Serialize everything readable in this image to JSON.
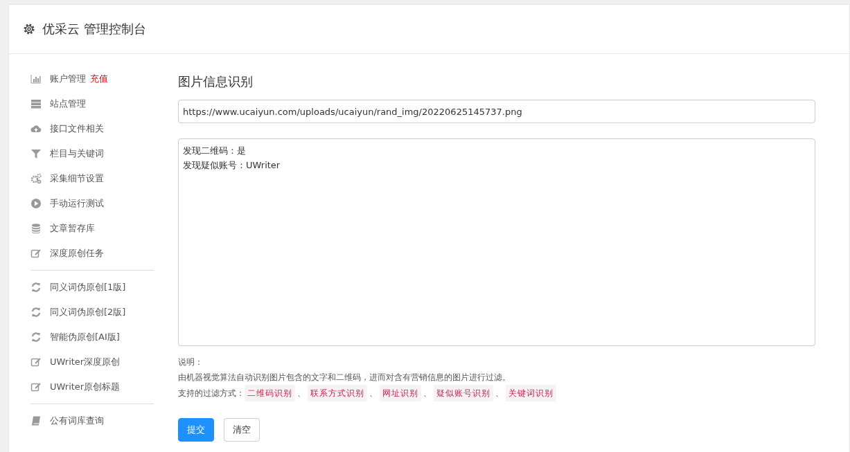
{
  "header": {
    "title": "优采云 管理控制台"
  },
  "sidebar": {
    "groups": [
      {
        "items": [
          {
            "label": "账户管理",
            "badge": "充值"
          },
          {
            "label": "站点管理"
          },
          {
            "label": "接口文件相关"
          },
          {
            "label": "栏目与关键词"
          },
          {
            "label": "采集细节设置"
          },
          {
            "label": "手动运行测试"
          },
          {
            "label": "文章暂存库"
          },
          {
            "label": "深度原创任务"
          }
        ]
      },
      {
        "items": [
          {
            "label": "同义词伪原创[1版]"
          },
          {
            "label": "同义词伪原创[2版]"
          },
          {
            "label": "智能伪原创[AI版]"
          },
          {
            "label": "UWriter深度原创"
          },
          {
            "label": "UWriter原创标题"
          }
        ]
      },
      {
        "items": [
          {
            "label": "公有词库查询"
          }
        ]
      }
    ]
  },
  "main": {
    "title": "图片信息识别",
    "url_field": {
      "value": "https://www.ucaiyun.com/uploads/ucaiyun/rand_img/20220625145737.png"
    },
    "result": {
      "lines": [
        "发现二维码：是",
        "发现疑似账号：UWriter"
      ]
    },
    "note_heading": "说明：",
    "note_text": "由机器视觉算法自动识别图片包含的文字和二维码，进而对含有营销信息的图片进行过滤。",
    "filters_label": "支持的过滤方式：",
    "filter_separator": "、",
    "filters": [
      "二维码识别",
      "联系方式识别",
      "网址识别",
      "疑似账号识别",
      "关键词识别"
    ],
    "buttons": [
      {
        "label": "提交",
        "kind": "primary"
      },
      {
        "label": "清空",
        "kind": "default"
      }
    ]
  }
}
